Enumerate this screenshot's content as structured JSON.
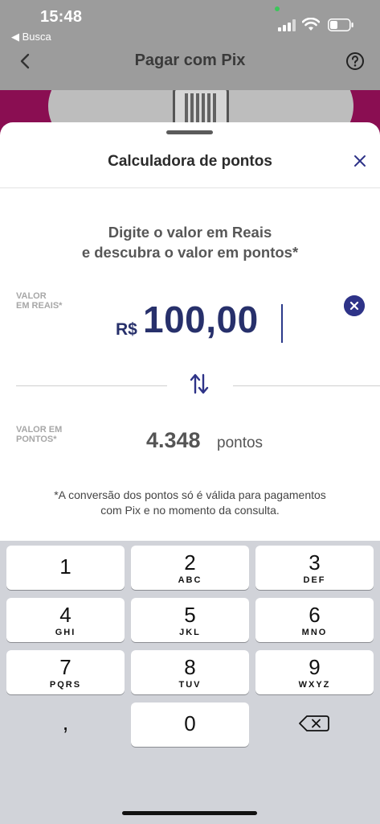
{
  "status": {
    "time": "15:48",
    "back_app": "◀ Busca"
  },
  "nav": {
    "title": "Pagar com Pix"
  },
  "sheet": {
    "title": "Calculadora de pontos",
    "instruction_line1": "Digite o valor em Reais",
    "instruction_line2": "e descubra o valor em pontos*",
    "reais_label_line1": "VALOR",
    "reais_label_line2": "EM REAIS*",
    "currency": "R$",
    "amount": "100,00",
    "points_label_line1": "VALOR EM",
    "points_label_line2": "PONTOS*",
    "points_value": "4.348",
    "points_unit": "pontos",
    "disclaimer_line1": "*A conversão dos pontos só é válida para pagamentos",
    "disclaimer_line2": "com Pix e no momento da consulta."
  },
  "keyboard": {
    "keys": [
      {
        "num": "1",
        "letters": ""
      },
      {
        "num": "2",
        "letters": "ABC"
      },
      {
        "num": "3",
        "letters": "DEF"
      },
      {
        "num": "4",
        "letters": "GHI"
      },
      {
        "num": "5",
        "letters": "JKL"
      },
      {
        "num": "6",
        "letters": "MNO"
      },
      {
        "num": "7",
        "letters": "PQRS"
      },
      {
        "num": "8",
        "letters": "TUV"
      },
      {
        "num": "9",
        "letters": "WXYZ"
      },
      {
        "num": "0",
        "letters": ""
      }
    ],
    "comma": ","
  },
  "colors": {
    "accent": "#2e3388",
    "brand_magenta": "#8a0e52",
    "amount_text": "#27306b"
  },
  "icons": [
    "chevron-left-icon",
    "help-circle-icon",
    "close-icon",
    "clear-circle-icon",
    "swap-vertical-icon",
    "backspace-icon",
    "signal-icon",
    "wifi-icon",
    "battery-icon"
  ]
}
